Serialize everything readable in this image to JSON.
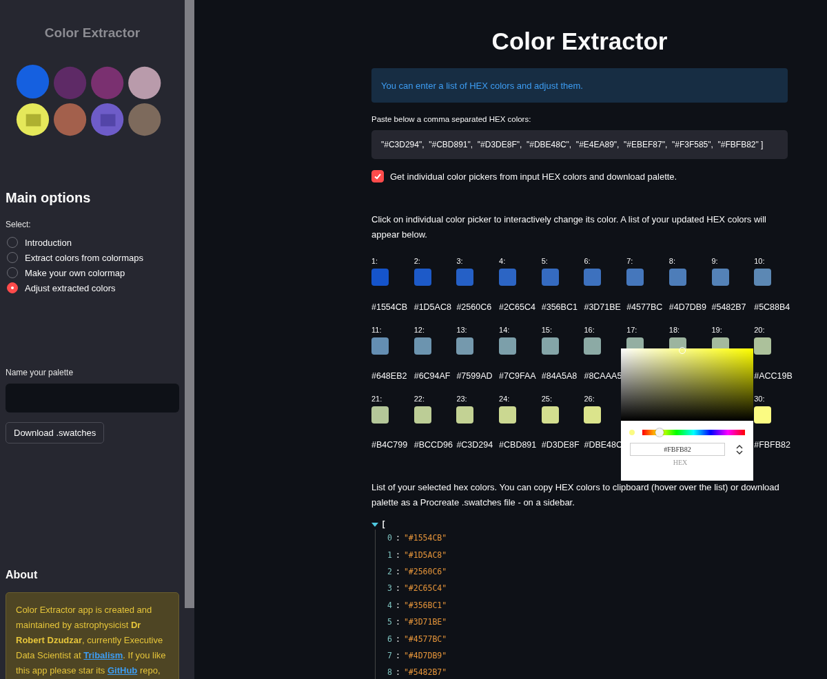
{
  "sidebar": {
    "app_title": "Color Extractor",
    "heading": "Main options",
    "select_label": "Select:",
    "options": [
      {
        "label": "Introduction",
        "selected": false
      },
      {
        "label": "Extract colors from colormaps",
        "selected": false
      },
      {
        "label": "Make your own colormap",
        "selected": false
      },
      {
        "label": "Adjust extracted colors",
        "selected": true
      }
    ],
    "name_label": "Name your palette",
    "download_button": "Download .swatches",
    "about_heading": "About",
    "about": [
      {
        "kind": "plain",
        "text": "Color Extractor app is created and maintained by astrophysicist "
      },
      {
        "kind": "bold",
        "text": "Dr Robert Dzudzar"
      },
      {
        "kind": "plain",
        "text": ", currently Executive Data Scientist at "
      },
      {
        "kind": "link",
        "text": "Tribalism"
      },
      {
        "kind": "plain",
        "text": ". If you like this app please star its "
      },
      {
        "kind": "link",
        "text": "GitHub"
      },
      {
        "kind": "plain",
        "text": " repo,"
      }
    ]
  },
  "main": {
    "title": "Color Extractor",
    "info": "You can enter a list of HEX colors and adjust them.",
    "input_label": "Paste below a comma separated HEX colors:",
    "input_value": "\"#C3D294\",  \"#CBD891\",  \"#D3DE8F\",  \"#DBE48C\",  \"#E4EA89\",  \"#EBEF87\",  \"#F3F585\",  \"#FBFB82\" ]",
    "checkbox": {
      "label": "Get individual color pickers from input HEX colors and download palette.",
      "checked": true
    },
    "picker_intro": "Click on individual color picker to interactively change its color. A list of your updated HEX colors will appear below.",
    "swatch_rows": [
      [
        {
          "label": "1:",
          "color": "#1554cb",
          "hex": "#1554CB"
        },
        {
          "label": "2:",
          "color": "#1d5ac8",
          "hex": "#1D5AC8"
        },
        {
          "label": "3:",
          "color": "#2560c6",
          "hex": "#2560C6"
        },
        {
          "label": "4:",
          "color": "#2c65c4",
          "hex": "#2C65C4"
        },
        {
          "label": "5:",
          "color": "#356bc1",
          "hex": "#356BC1"
        },
        {
          "label": "6:",
          "color": "#3d71be",
          "hex": "#3D71BE"
        },
        {
          "label": "7:",
          "color": "#4577bc",
          "hex": "#4577BC"
        },
        {
          "label": "8:",
          "color": "#4d7db9",
          "hex": "#4D7DB9"
        },
        {
          "label": "9:",
          "color": "#5482b7",
          "hex": "#5482B7"
        },
        {
          "label": "10:",
          "color": "#5c88b4",
          "hex": "#5C88B4"
        }
      ],
      [
        {
          "label": "11:",
          "color": "#648eb2",
          "hex": "#648EB2"
        },
        {
          "label": "12:",
          "color": "#6c94af",
          "hex": "#6C94AF"
        },
        {
          "label": "13:",
          "color": "#7599ad",
          "hex": "#7599AD"
        },
        {
          "label": "14:",
          "color": "#7c9faa",
          "hex": "#7C9FAA"
        },
        {
          "label": "15:",
          "color": "#84a5a8",
          "hex": "#84A5A8"
        },
        {
          "label": "16:",
          "color": "#8caaa5",
          "hex": "#8CAAA5"
        },
        {
          "label": "17:",
          "color": "#94afa2"
        },
        {
          "label": "18:",
          "color": "#9cb49f"
        },
        {
          "label": "19:",
          "color": "#a4ba9d"
        },
        {
          "label": "20:",
          "color": "#acc19b",
          "hex": "#ACC19B"
        }
      ],
      [
        {
          "label": "21:",
          "color": "#b4c799",
          "hex": "#B4C799"
        },
        {
          "label": "22:",
          "color": "#bccd96",
          "hex": "#BCCD96"
        },
        {
          "label": "23:",
          "color": "#c3d294",
          "hex": "#C3D294"
        },
        {
          "label": "24:",
          "color": "#cbd891",
          "hex": "#CBD891"
        },
        {
          "label": "25:",
          "color": "#d3de8f",
          "hex": "#D3DE8F"
        },
        {
          "label": "26:",
          "color": "#dbe48c",
          "hex": "#DBE48C"
        },
        {
          "label": "30:",
          "color": "#fbfb82",
          "hex": "#FBFB82"
        }
      ]
    ],
    "picker": {
      "level": 0.17,
      "value": "#FBFB82",
      "mode_label": "HEX"
    },
    "list_intro": "List of your selected hex colors. You can copy HEX colors to clipboard (hover over the list) or download palette as a Procreate .swatches file - on a sidebar.",
    "json_tree": {
      "expanded": true,
      "open_bracket": "[",
      "items": [
        {
          "index": "0",
          "sep": ":",
          "value": "\"#1554CB\""
        },
        {
          "index": "1",
          "sep": ":",
          "value": "\"#1D5AC8\""
        },
        {
          "index": "2",
          "sep": ":",
          "value": "\"#2560C6\""
        },
        {
          "index": "3",
          "sep": ":",
          "value": "\"#2C65C4\""
        },
        {
          "index": "4",
          "sep": ":",
          "value": "\"#356BC1\""
        },
        {
          "index": "5",
          "sep": ":",
          "value": "\"#3D71BE\""
        },
        {
          "index": "6",
          "sep": ":",
          "value": "\"#4577BC\""
        },
        {
          "index": "7",
          "sep": ":",
          "value": "\"#4D7DB9\""
        },
        {
          "index": "8",
          "sep": ":",
          "value": "\"#5482B7\""
        }
      ]
    }
  }
}
